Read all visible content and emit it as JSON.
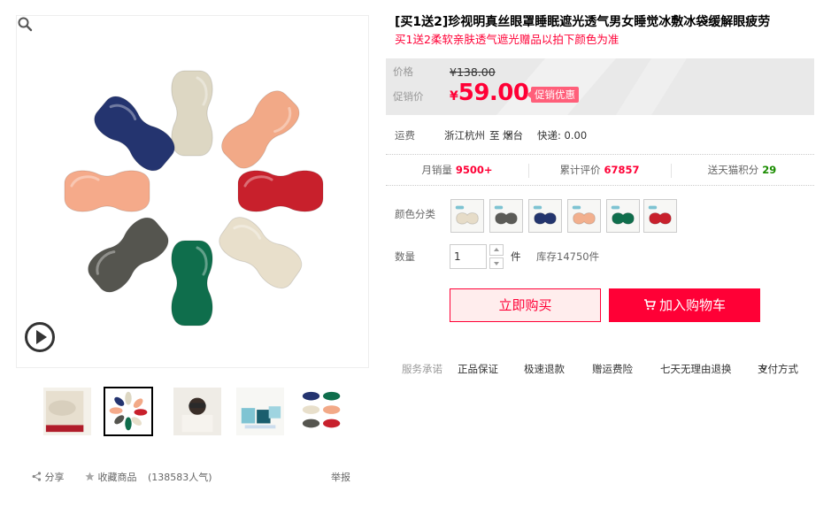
{
  "product": {
    "title": "[买1送2]珍视明真丝眼罩睡眠遮光透气男女睡觉冰敷冰袋缓解眼疲劳",
    "subtitle": "买1送2柔软亲肤透气遮光赠品以拍下颜色为准"
  },
  "price": {
    "label": "价格",
    "original": "¥138.00",
    "promo_label": "促销价",
    "currency": "¥",
    "promo": "59.00",
    "promo_tag": "促销优惠"
  },
  "shipping": {
    "label": "运费",
    "from": "浙江杭州",
    "to_word": "至",
    "to": "烟台",
    "express": "快递: 0.00"
  },
  "stats": {
    "monthly_label": "月销量",
    "monthly_value": "9500+",
    "reviews_label": "累计评价",
    "reviews_value": "67857",
    "points_label": "送天猫积分",
    "points_value": "29"
  },
  "color": {
    "label": "颜色分类",
    "options": [
      {
        "name": "米白",
        "color": "#e6dcc8"
      },
      {
        "name": "灰色",
        "color": "#5b5b57"
      },
      {
        "name": "藏蓝",
        "color": "#23356e"
      },
      {
        "name": "粉橙",
        "color": "#f2b08e"
      },
      {
        "name": "墨绿",
        "color": "#0f6e4c"
      },
      {
        "name": "红色",
        "color": "#c8202c"
      }
    ]
  },
  "quantity": {
    "label": "数量",
    "value": "1",
    "unit": "件",
    "stock": "库存14750件"
  },
  "buttons": {
    "buy": "立即购买",
    "cart": "加入购物车"
  },
  "service": {
    "label": "服务承诺",
    "items": [
      "正品保证",
      "极速退款",
      "赠运费险",
      "七天无理由退换"
    ],
    "payment": "支付方式"
  },
  "footer": {
    "share": "分享",
    "favorite": "收藏商品",
    "popularity": "(138583人气)",
    "report": "举报"
  },
  "masks": [
    {
      "color": "#ddd7c3",
      "angle": 90
    },
    {
      "color": "#f2a987",
      "angle": 135
    },
    {
      "color": "#c8202c",
      "angle": 0
    },
    {
      "color": "#e8dfcb",
      "angle": 35
    },
    {
      "color": "#0f6e4c",
      "angle": 90
    },
    {
      "color": "#55554f",
      "angle": -40
    },
    {
      "color": "#f5aa8a",
      "angle": 0
    },
    {
      "color": "#24346f",
      "angle": 40
    }
  ]
}
